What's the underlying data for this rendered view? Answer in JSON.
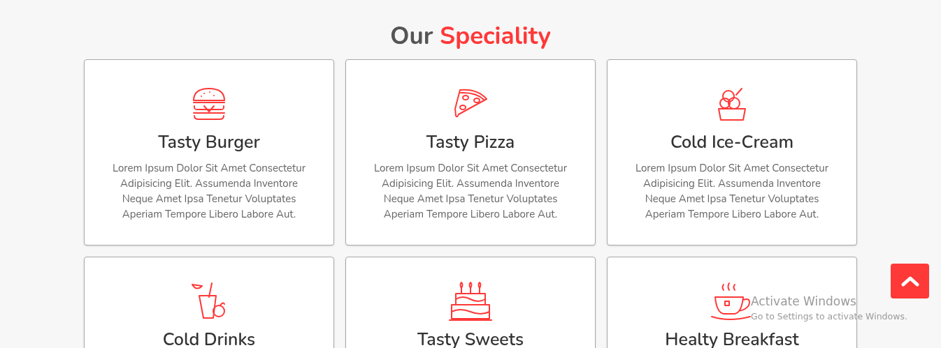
{
  "heading": {
    "lead": "Our",
    "accent": "Speciality"
  },
  "cards": [
    {
      "kind": "burger",
      "title": "Tasty Burger",
      "description": "Lorem Ipsum Dolor Sit Amet Consectetur Adipisicing Elit. Assumenda Inventore Neque Amet Ipsa Tenetur Voluptates Aperiam Tempore Libero Labore Aut."
    },
    {
      "kind": "pizza",
      "title": "Tasty Pizza",
      "description": "Lorem Ipsum Dolor Sit Amet Consectetur Adipisicing Elit. Assumenda Inventore Neque Amet Ipsa Tenetur Voluptates Aperiam Tempore Libero Labore Aut."
    },
    {
      "kind": "icecream",
      "title": "Cold Ice-Cream",
      "description": "Lorem Ipsum Dolor Sit Amet Consectetur Adipisicing Elit. Assumenda Inventore Neque Amet Ipsa Tenetur Voluptates Aperiam Tempore Libero Labore Aut."
    },
    {
      "kind": "drink",
      "title": "Cold Drinks"
    },
    {
      "kind": "cake",
      "title": "Tasty Sweets"
    },
    {
      "kind": "tea",
      "title": "Healty Breakfast"
    }
  ],
  "activation_notice": {
    "title": "Activate Windows",
    "subtitle": "Go to Settings to activate Windows."
  }
}
